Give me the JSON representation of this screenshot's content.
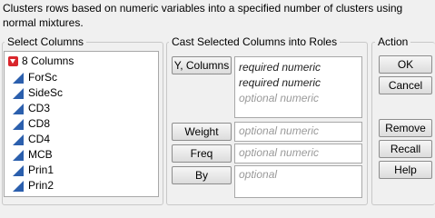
{
  "description": "Clusters rows based on numeric variables into a specified number of clusters using normal mixtures.",
  "select_columns": {
    "title": "Select Columns",
    "count_label": "8 Columns",
    "columns": [
      "ForSc",
      "SideSc",
      "CD3",
      "CD8",
      "CD4",
      "MCB",
      "Prin1",
      "Prin2"
    ]
  },
  "cast": {
    "title": "Cast Selected Columns into Roles",
    "roles": [
      {
        "button": "Y, Columns",
        "lines": [
          "required numeric",
          "required numeric",
          "optional numeric"
        ]
      },
      {
        "button": "Weight",
        "lines": [
          "optional numeric"
        ]
      },
      {
        "button": "Freq",
        "lines": [
          "optional numeric"
        ]
      },
      {
        "button": "By",
        "lines": [
          "optional"
        ]
      }
    ]
  },
  "action": {
    "title": "Action",
    "ok": "OK",
    "cancel": "Cancel",
    "remove": "Remove",
    "recall": "Recall",
    "help": "Help"
  }
}
